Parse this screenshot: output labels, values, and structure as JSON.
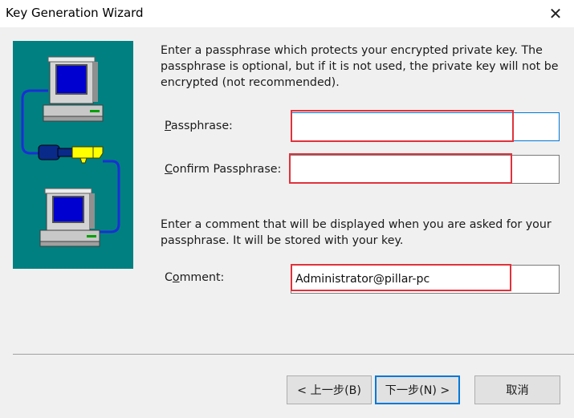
{
  "window": {
    "title": "Key Generation Wizard",
    "close_glyph": "✕"
  },
  "illustration": {
    "icon": "computers-with-key-icon",
    "bg_color": "#008080"
  },
  "intro_text": "Enter a passphrase which protects your encrypted private key.  The passphrase is optional, but if it is not used, the private key will not be encrypted (not recommended).",
  "passphrase": {
    "label_mnemonic": "P",
    "label_rest": "assphrase:",
    "value": ""
  },
  "confirm": {
    "label_mnemonic": "C",
    "label_rest": "onfirm Passphrase:",
    "value": ""
  },
  "comment_text": "Enter a comment that will be displayed when you are asked for your passphrase. It will be stored with your key.",
  "comment": {
    "label_pre": "C",
    "label_mnemonic": "o",
    "label_rest": "mment:",
    "value": "Administrator@pillar-pc"
  },
  "buttons": {
    "back": "< 上一步(B)",
    "next": "下一步(N) >",
    "cancel": "取消"
  },
  "colors": {
    "highlight": "#e0323c",
    "focus": "#0078d7",
    "teal": "#008080"
  }
}
